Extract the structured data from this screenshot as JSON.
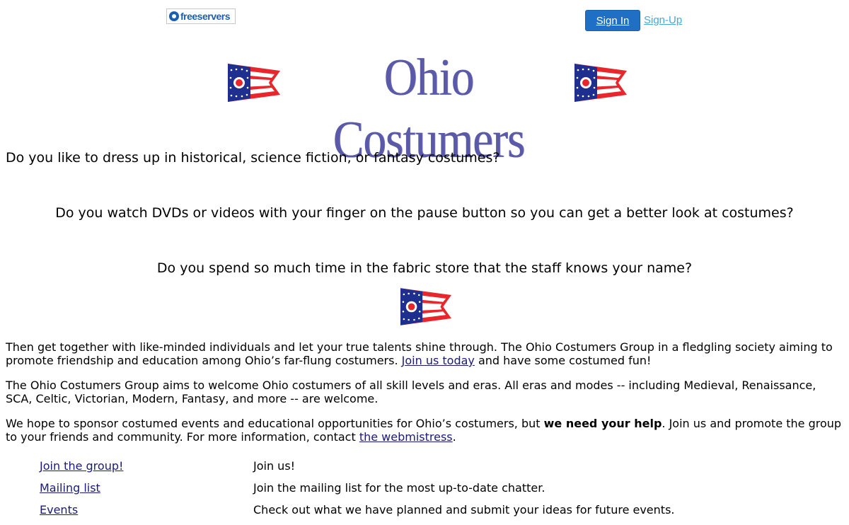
{
  "header": {
    "logo_text": "freeservers",
    "signin_label": "Sign In",
    "signup_label": "Sign-Up"
  },
  "banner": {
    "title": "Ohio Costumers"
  },
  "questions": [
    "Do you like to dress up in historical, science fiction, or fantasy costumes?",
    "Do you watch DVDs or videos with your finger on the pause button so you can get a better look at costumes?",
    "Do you spend so much time in the fabric store that the staff knows your name?"
  ],
  "para1": {
    "text": "Then get together with like-minded individuals and let your true talents shine through.  The Ohio Costumers Group in a fledgling society aiming to promote friendship and education among Ohio’s far-flung costumers.  ",
    "link": "Join us today",
    "tail": " and have some costumed fun!"
  },
  "para2": {
    "text": "The Ohio Costumers Group aims to welcome Ohio costumers of all skill levels and eras.   All eras and modes -- including Medieval, Renaissance, SCA, Celtic, Victorian, Modern, Fantasy, and more -- are welcome."
  },
  "para3": {
    "text": "We hope to sponsor costumed events and educational opportunities for Ohio’s costumers, but ",
    "bold": "we need your help",
    "mid": ".  Join us and promote the group to your friends and community.  For more information, contact ",
    "link": "the webmistress",
    "tail": "."
  },
  "links": [
    {
      "label": "Join the group!",
      "desc": "Join us!"
    },
    {
      "label": "Mailing list",
      "desc": "Join the mailing list for the most up-to-date chatter."
    },
    {
      "label": "Events",
      "desc": "Check out what we have planned and submit your ideas for future events."
    }
  ],
  "colors": {
    "flag_red": "#e8262b",
    "flag_blue": "#1f2f8f",
    "title_color": "#5a5aa8",
    "signin_bg": "#1f6fc5",
    "signup_color": "#46a8d8",
    "link_color": "#1a1a7a"
  }
}
